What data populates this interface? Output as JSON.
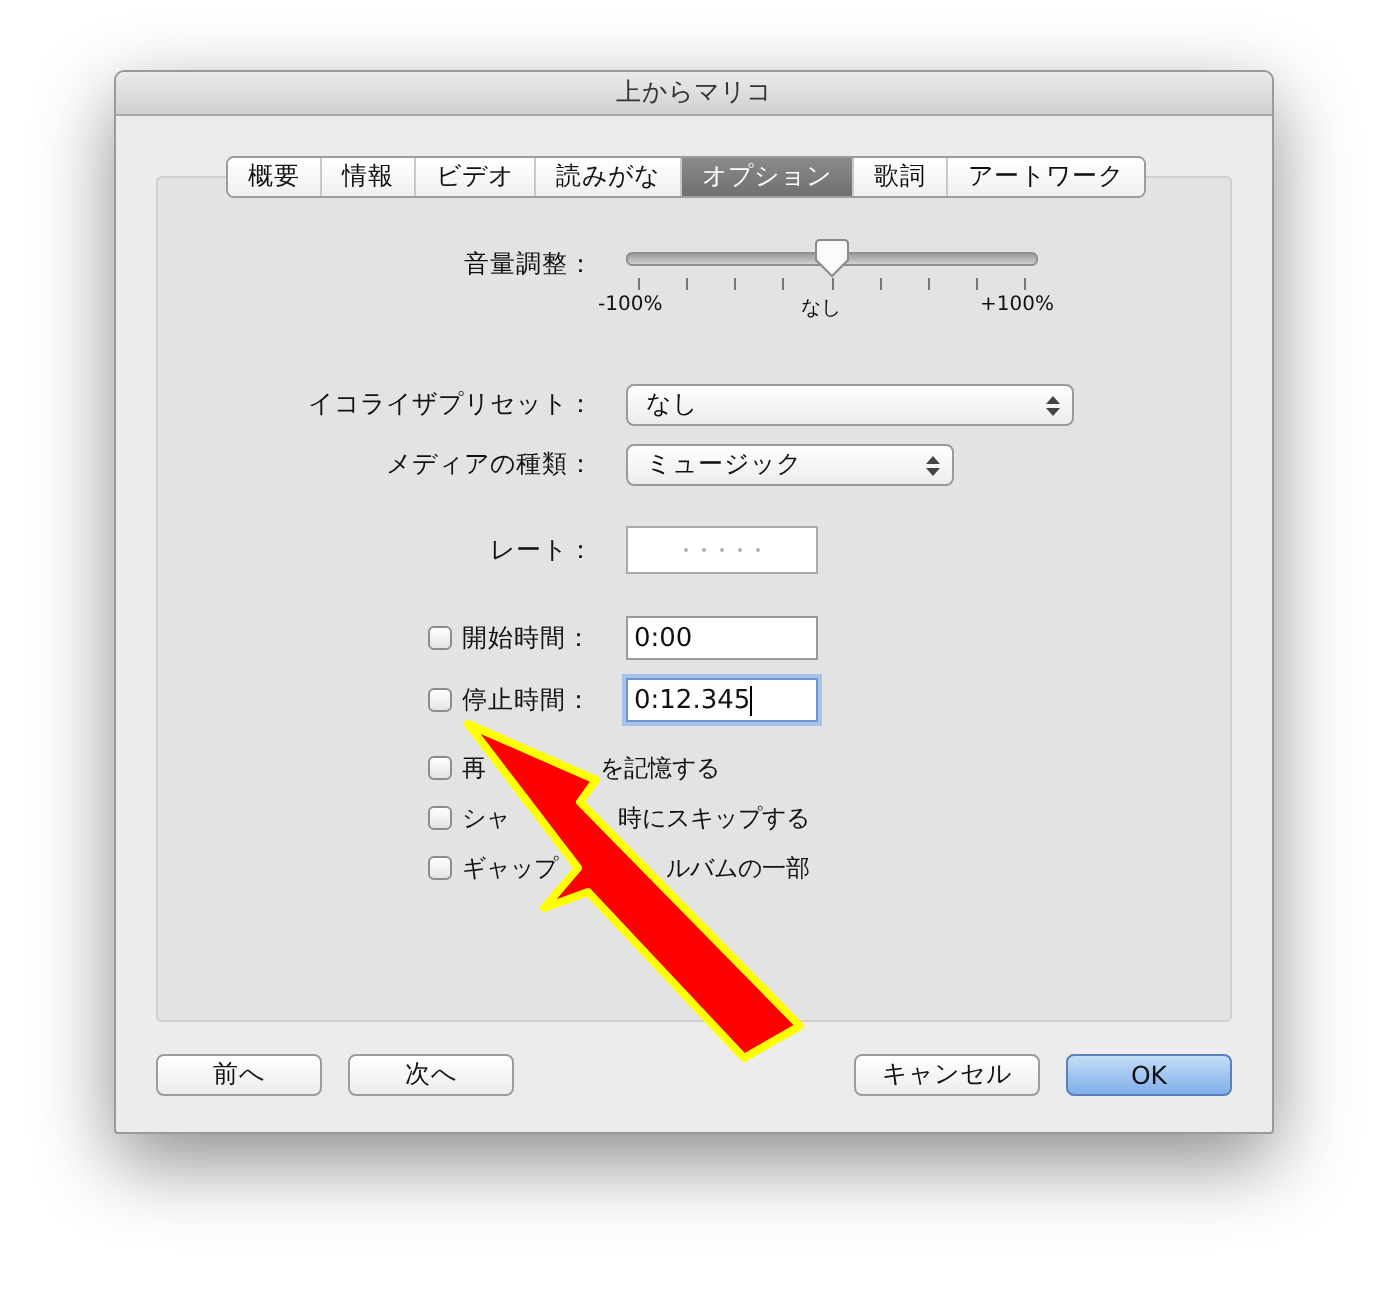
{
  "window": {
    "title": "上からマリコ"
  },
  "tabs": [
    {
      "label": "概要",
      "selected": false
    },
    {
      "label": "情報",
      "selected": false
    },
    {
      "label": "ビデオ",
      "selected": false
    },
    {
      "label": "読みがな",
      "selected": false
    },
    {
      "label": "オプション",
      "selected": true
    },
    {
      "label": "歌詞",
      "selected": false
    },
    {
      "label": "アートワーク",
      "selected": false
    }
  ],
  "volume": {
    "label": "音量調整：",
    "level": 0.5,
    "min_label": "-100%",
    "mid_label": "なし",
    "max_label": "+100%"
  },
  "equalizer": {
    "label": "イコライザプリセット：",
    "value": "なし"
  },
  "media_kind": {
    "label": "メディアの種類：",
    "value": "ミュージック"
  },
  "rating": {
    "label": "レート：",
    "stars": 0
  },
  "start_time": {
    "label": "開始時間：",
    "checked": false,
    "value": "0:00",
    "focused": false
  },
  "stop_time": {
    "label": "停止時間：",
    "checked": false,
    "value": "0:12.345",
    "focused": true
  },
  "options": [
    {
      "label_start": "再",
      "label_end": "を記憶する",
      "checked": false
    },
    {
      "label_start": "シャ",
      "label_end": "時にスキップする",
      "checked": false
    },
    {
      "label_start": "ギャップ",
      "label_end": "ルバムの一部",
      "checked": false
    }
  ],
  "buttons": [
    {
      "label": "前へ",
      "default": false
    },
    {
      "label": "次へ",
      "default": false
    },
    {
      "label": "キャンセル",
      "default": false
    },
    {
      "label": "OK",
      "default": true
    }
  ]
}
